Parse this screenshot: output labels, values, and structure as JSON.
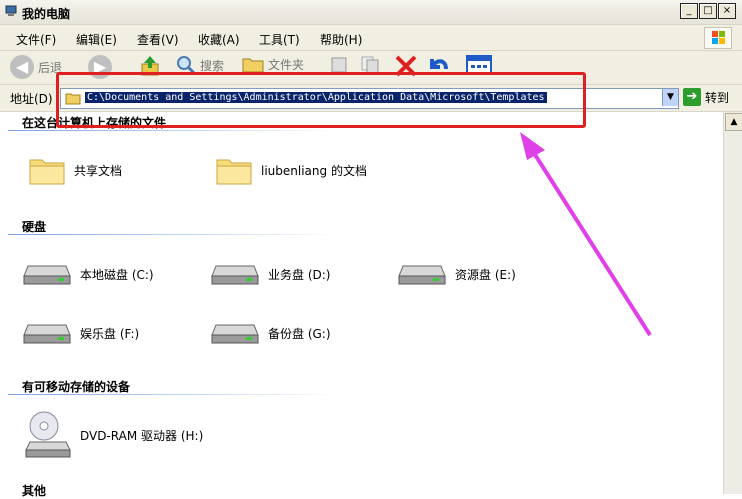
{
  "window": {
    "title": "我的电脑",
    "buttons": [
      "_",
      "□",
      "×"
    ]
  },
  "menu": [
    "文件(F)",
    "编辑(E)",
    "查看(V)",
    "收藏(A)",
    "工具(T)",
    "帮助(H)"
  ],
  "toolbar": {
    "back": "后退",
    "search": "搜索",
    "folders": "文件夹"
  },
  "address": {
    "label": "地址(D)",
    "value": "C:\\Documents and Settings\\Administrator\\Application Data\\Microsoft\\Templates",
    "go": "转到"
  },
  "sections": {
    "files": "在这台计算机上存储的文件",
    "hdd": "硬盘",
    "removable": "有可移动存储的设备",
    "other": "其他"
  },
  "folders": [
    "共享文档",
    "liubenliang 的文档"
  ],
  "drives": [
    "本地磁盘 (C:)",
    "业务盘 (D:)",
    "资源盘 (E:)",
    "娱乐盘 (F:)",
    "备份盘 (G:)"
  ],
  "removable": [
    "DVD-RAM 驱动器 (H:)"
  ],
  "colors": {
    "highlight_box": "#e02020",
    "annotation_arrow": "#e040e8",
    "selection": "#0a246a"
  }
}
